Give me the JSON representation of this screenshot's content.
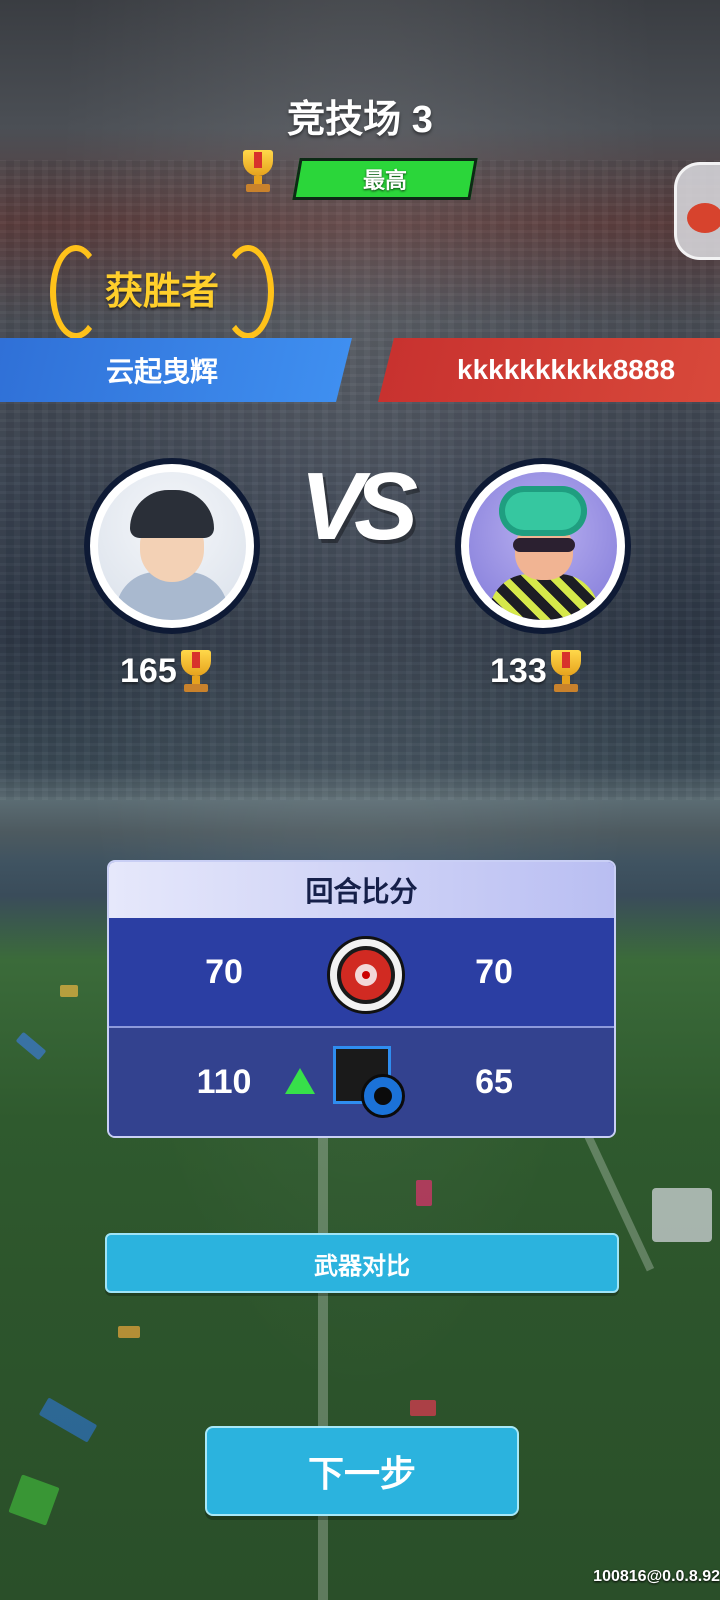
{
  "arena": {
    "title": "竞技场 3",
    "rank_label": "最高"
  },
  "result": {
    "winner_label": "获胜者"
  },
  "players": {
    "left": {
      "name": "云起曳辉",
      "trophies": "165"
    },
    "right": {
      "name": "kkkkkkkkkk8888",
      "trophies": "133"
    }
  },
  "vs_label": "VS",
  "scoreboard": {
    "header": "回合比分",
    "rows": [
      {
        "icon": "target-icon",
        "left": "70",
        "right": "70"
      },
      {
        "icon": "shapes-icon",
        "left": "110",
        "right": "65"
      }
    ]
  },
  "buttons": {
    "weapon_compare": "武器对比",
    "next": "下一步"
  },
  "version": "100816@0.0.8.92",
  "colors": {
    "blue_team": "#3f8ff0",
    "red_team": "#d94a3b",
    "rank_green": "#2bd63a",
    "button_cyan": "#2bb3de"
  }
}
